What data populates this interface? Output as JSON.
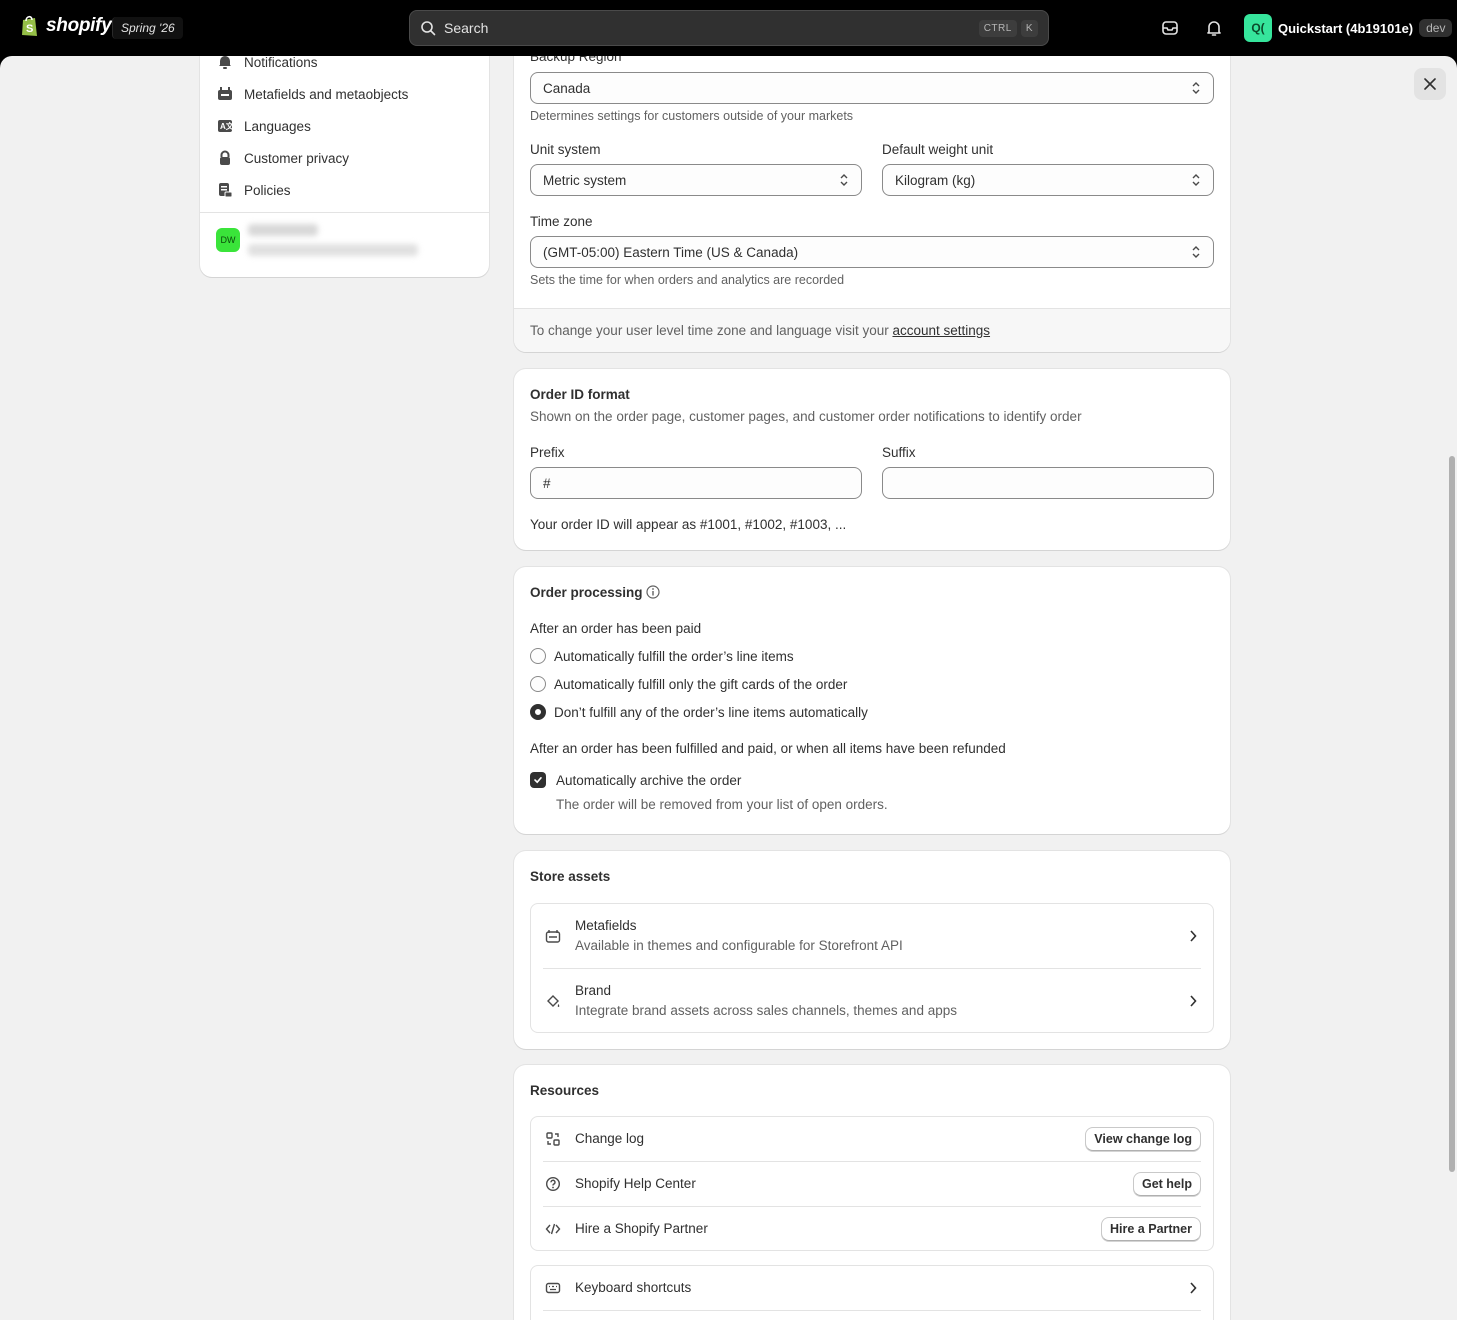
{
  "topbar": {
    "brand": "shopify",
    "edition": "Spring '26",
    "search_placeholder": "Search",
    "shortcut_key1": "CTRL",
    "shortcut_key2": "K",
    "store_avatar": "Q(",
    "store_name": "Quickstart (4b19101e)",
    "store_badge": "dev"
  },
  "sidebar": {
    "items": [
      {
        "label": "Notifications",
        "icon": "bell-icon"
      },
      {
        "label": "Metafields and metaobjects",
        "icon": "metafields-icon"
      },
      {
        "label": "Languages",
        "icon": "language-icon"
      },
      {
        "label": "Customer privacy",
        "icon": "lock-icon"
      },
      {
        "label": "Policies",
        "icon": "policy-icon"
      }
    ],
    "user_avatar": "DW"
  },
  "defaults_card": {
    "backup_region_label": "Backup Region",
    "backup_region_value": "Canada",
    "backup_region_help": "Determines settings for customers outside of your markets",
    "unit_system_label": "Unit system",
    "unit_system_value": "Metric system",
    "weight_unit_label": "Default weight unit",
    "weight_unit_value": "Kilogram (kg)",
    "time_zone_label": "Time zone",
    "time_zone_value": "(GMT-05:00) Eastern Time (US & Canada)",
    "time_zone_help": "Sets the time for when orders and analytics are recorded",
    "footer_text": "To change your user level time zone and language visit your ",
    "footer_link": "account settings"
  },
  "order_id_card": {
    "title": "Order ID format",
    "description": "Shown on the order page, customer pages, and customer order notifications to identify order",
    "prefix_label": "Prefix",
    "prefix_value": "#",
    "suffix_label": "Suffix",
    "suffix_value": "",
    "preview": "Your order ID will appear as #1001, #1002, #1003, ..."
  },
  "order_processing_card": {
    "title": "Order processing",
    "paid_heading": "After an order has been paid",
    "options": [
      {
        "label": "Automatically fulfill the order’s line items",
        "selected": false
      },
      {
        "label": "Automatically fulfill only the gift cards of the order",
        "selected": false
      },
      {
        "label": "Don’t fulfill any of the order’s line items automatically",
        "selected": true
      }
    ],
    "fulfilled_heading": "After an order has been fulfilled and paid, or when all items have been refunded",
    "archive_label": "Automatically archive the order",
    "archive_checked": true,
    "archive_help": "The order will be removed from your list of open orders."
  },
  "store_assets_card": {
    "title": "Store assets",
    "items": [
      {
        "title": "Metafields",
        "subtitle": "Available in themes and configurable for Storefront API",
        "icon": "metafields-icon"
      },
      {
        "title": "Brand",
        "subtitle": "Integrate brand assets across sales channels, themes and apps",
        "icon": "brand-paint-icon"
      }
    ]
  },
  "resources_card": {
    "title": "Resources",
    "items": [
      {
        "title": "Change log",
        "button": "View change log",
        "icon": "change-log-icon"
      },
      {
        "title": "Shopify Help Center",
        "button": "Get help",
        "icon": "help-circle-icon"
      },
      {
        "title": "Hire a Shopify Partner",
        "button": "Hire a Partner",
        "icon": "code-icon"
      }
    ],
    "keyboard_shortcuts": "Keyboard shortcuts"
  }
}
